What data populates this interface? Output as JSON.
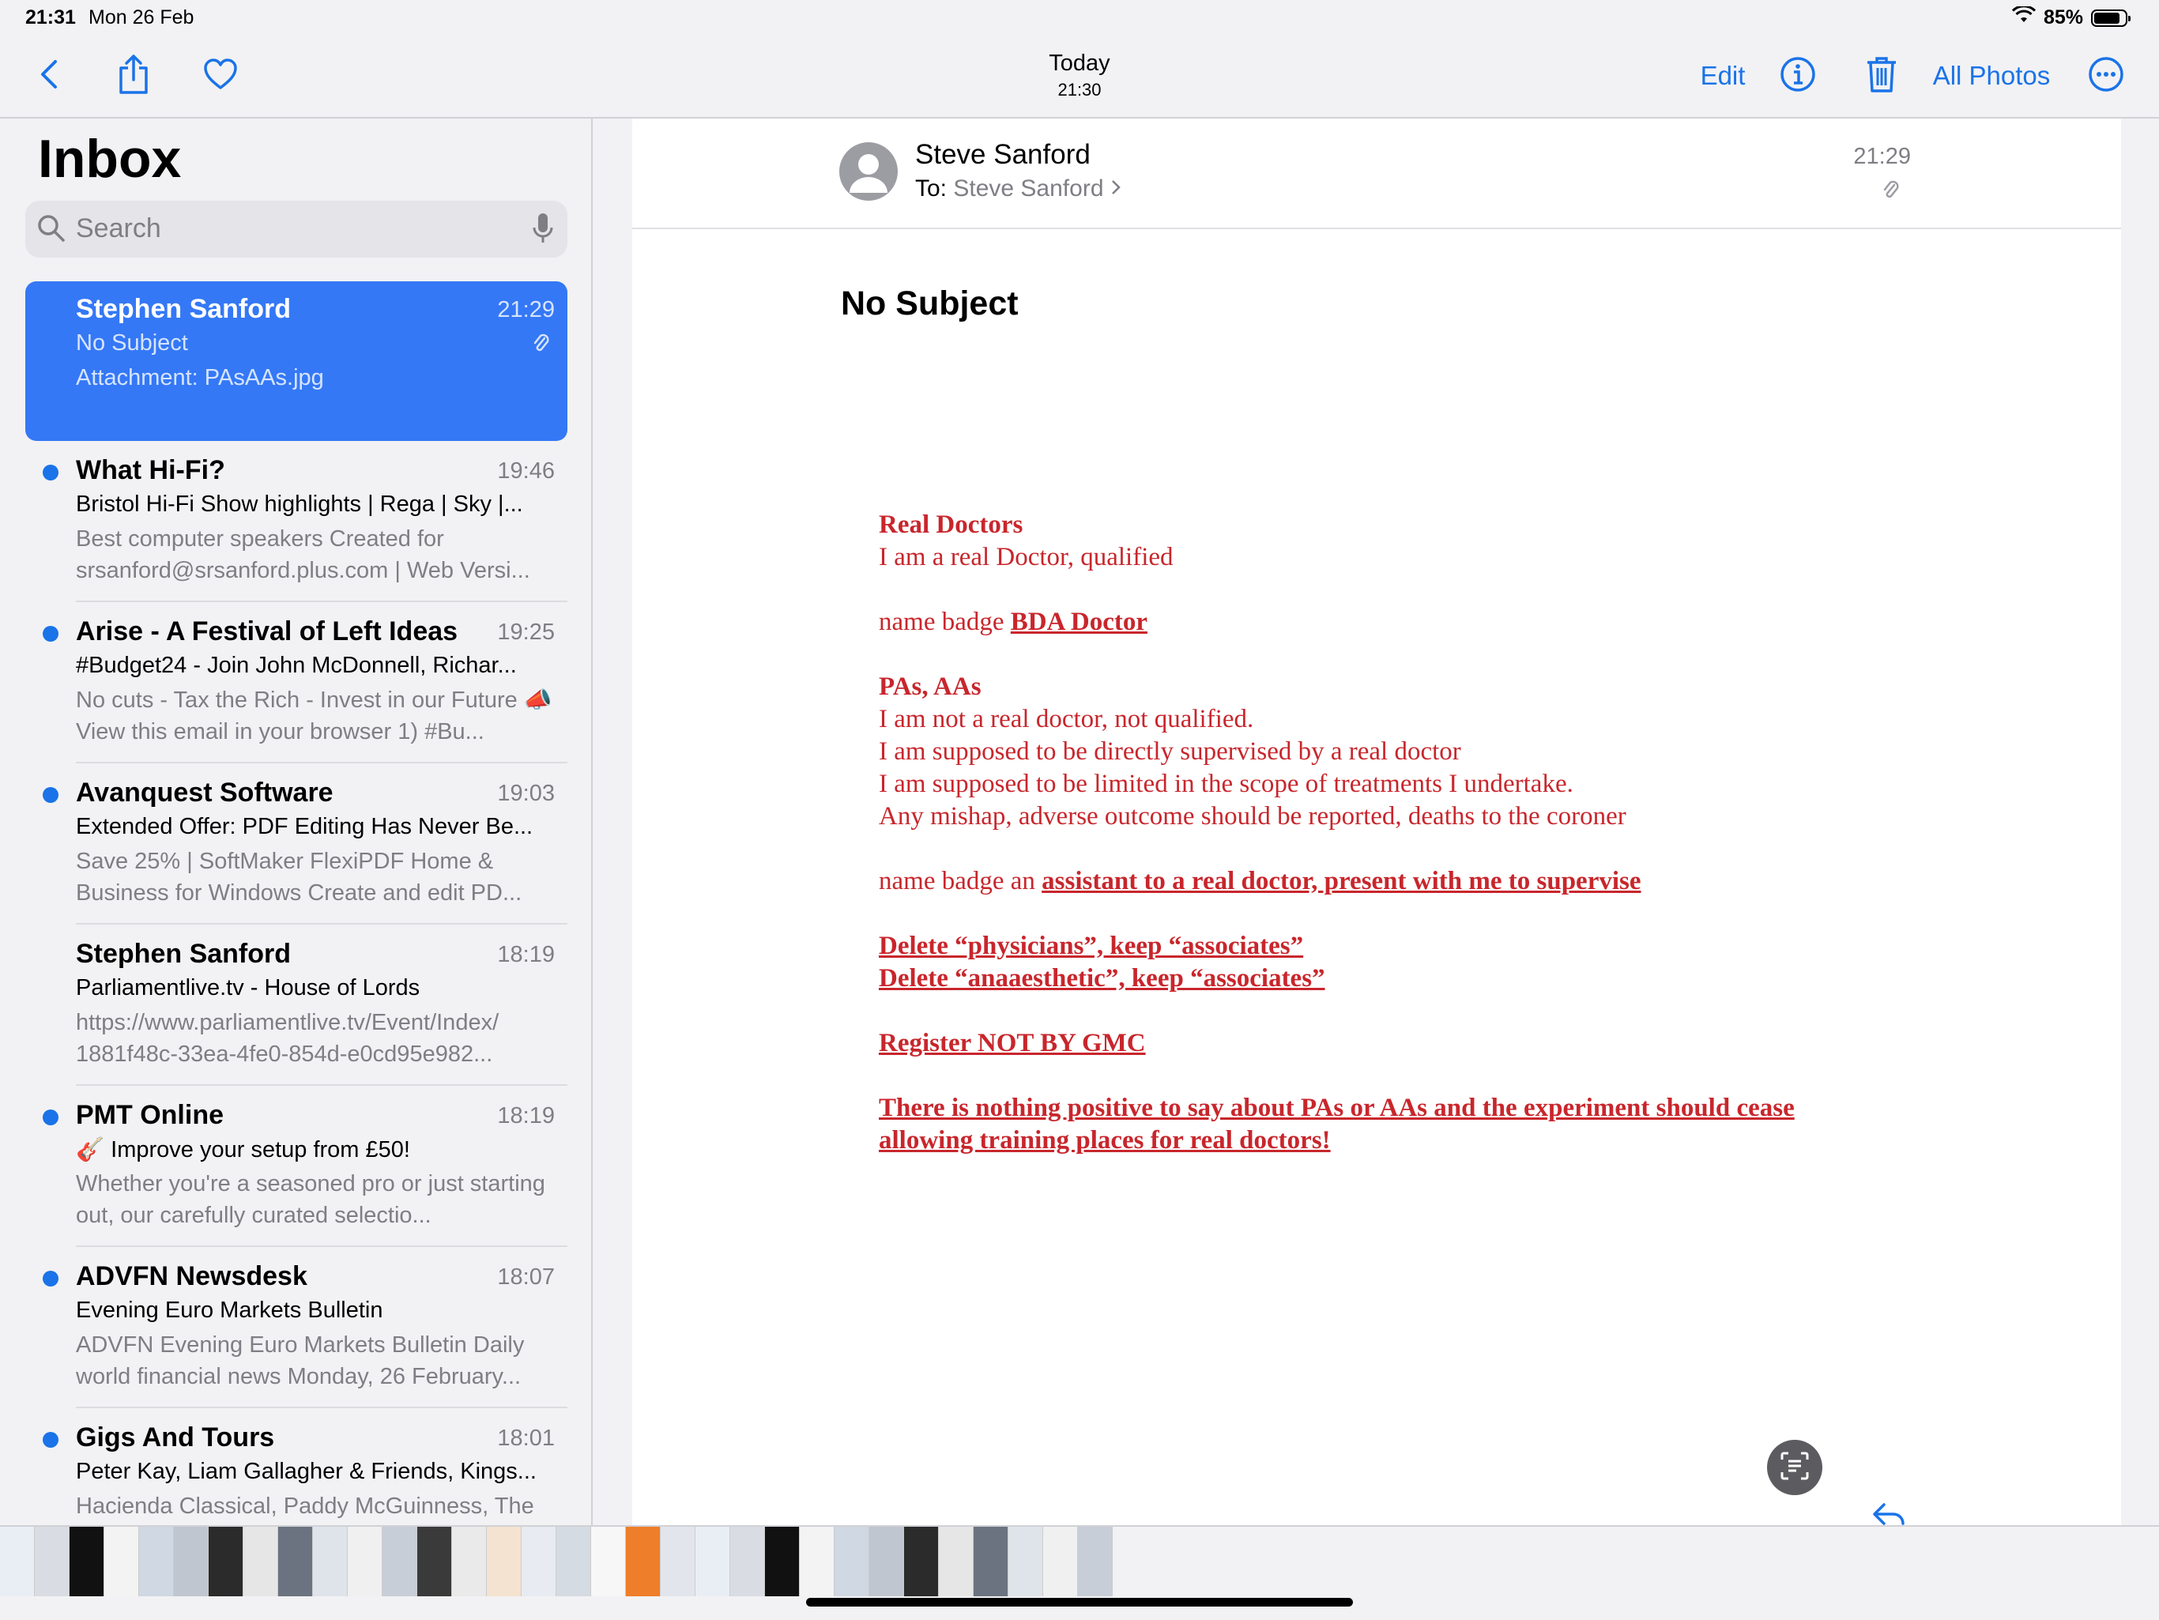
{
  "status": {
    "time": "21:31",
    "date": "Mon 26 Feb",
    "battery": "85%",
    "battery_level": 0.85
  },
  "toolbar": {
    "title": "Today",
    "subtitle": "21:30",
    "edit_label": "Edit",
    "all_photos_label": "All Photos",
    "icons": [
      "back-chevron-icon",
      "share-icon",
      "heart-icon",
      "info-icon",
      "trash-icon",
      "more-icon"
    ]
  },
  "sidebar": {
    "title": "Inbox",
    "search_placeholder": "Search",
    "messages": [
      {
        "sender": "Stephen Sanford",
        "time": "21:29",
        "subject": "No Subject",
        "preview": "Attachment: PAsAAs.jpg",
        "unread": false,
        "selected": true,
        "attachment": true
      },
      {
        "sender": "What Hi-Fi?",
        "time": "19:46",
        "subject": "Bristol Hi-Fi Show highlights | Rega | Sky |...",
        "preview": "Best computer speakers Created for srsanford@srsanford.plus.com | Web Versi...",
        "unread": true
      },
      {
        "sender": "Arise - A Festival of Left Ideas",
        "time": "19:25",
        "subject": "#Budget24 - Join John McDonnell, Richar...",
        "preview": "No cuts - Tax the Rich - Invest in our Future 📣 View this email in your browser 1) #Bu...",
        "unread": true
      },
      {
        "sender": "Avanquest Software",
        "time": "19:03",
        "subject": "Extended Offer: PDF Editing Has Never Be...",
        "preview": "Save 25% | SoftMaker FlexiPDF Home & Business for Windows Create and edit PD...",
        "unread": true
      },
      {
        "sender": "Stephen Sanford",
        "time": "18:19",
        "subject": "Parliamentlive.tv - House of Lords",
        "preview": "https://www.parliamentlive.tv/Event/Index/ 1881f48c-33ea-4fe0-854d-e0cd95e982...",
        "unread": false
      },
      {
        "sender": "PMT Online",
        "time": "18:19",
        "subject": "🎸 Improve your setup from £50!",
        "preview": "Whether you're a seasoned pro or just starting out, our carefully curated selectio...",
        "unread": true
      },
      {
        "sender": "ADVFN Newsdesk",
        "time": "18:07",
        "subject": "Evening Euro Markets Bulletin",
        "preview": "ADVFN Evening Euro Markets Bulletin Daily world financial news Monday, 26 February...",
        "unread": true
      },
      {
        "sender": "Gigs And Tours",
        "time": "18:01",
        "subject": "Peter Kay, Liam Gallagher & Friends, Kings...",
        "preview": "Hacienda Classical, Paddy McGuinness, The",
        "unread": true
      }
    ]
  },
  "message": {
    "from": "Steve Sanford",
    "to_label": "To:",
    "to": "Steve Sanford",
    "time": "21:29",
    "subject": "No Subject"
  },
  "document": {
    "line1": "Real Doctors",
    "line2": "I am a real Doctor, qualified",
    "line3_plain": "name badge ",
    "line3_link": "BDA Doctor",
    "line4": "PAs, AAs",
    "line5": "I am not a real doctor, not qualified.",
    "line6": "I am supposed to be directly supervised by a real doctor",
    "line7": "I am supposed to be limited in the scope of treatments I undertake.",
    "line8": "Any mishap, adverse outcome should be reported, deaths to the coroner",
    "line9_plain": "name badge an ",
    "line9_link": "assistant to a real doctor, present with me to supervise",
    "line10": "Delete “physicians”, keep “associates”",
    "line11": "Delete “anaaesthetic”, keep “associates”",
    "line12": "Register NOT BY GMC",
    "line13": "There is nothing positive to say about PAs or AAs and the experiment should cease",
    "line14": "allowing training places for real doctors!"
  }
}
